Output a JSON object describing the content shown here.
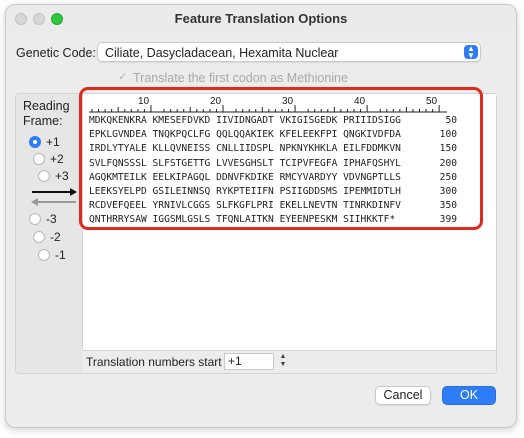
{
  "window": {
    "title": "Feature Translation Options"
  },
  "genetic_code": {
    "label": "Genetic Code:",
    "selected": "Ciliate, Dasycladacean, Hexamita Nuclear"
  },
  "methionine": {
    "label": "Translate the first codon as Methionine",
    "checked": true,
    "enabled": false
  },
  "reading_frame": {
    "label_line1": "Reading",
    "label_line2": "Frame:",
    "options": [
      "+1",
      "+2",
      "+3",
      "-3",
      "-2",
      "-1"
    ],
    "selected": "+1"
  },
  "ruler": {
    "ticks": [
      "10",
      "20",
      "30",
      "40",
      "50"
    ]
  },
  "sequence": {
    "lines": [
      {
        "seq": "MDKQKENKRA KMESEFDVKD IIVIDNGADT VKIGISGEDK PRIIIDSIGG",
        "num": "50"
      },
      {
        "seq": "EPKLGVNDEA TNQKPQCLFG QQLQQAKIEK KFELEEKFPI QNGKIVDFDA",
        "num": "100"
      },
      {
        "seq": "IRDLYTYALE KLLQVNEISS CNLLIIDSPL NPKNYKHKLA EILFDDMKVN",
        "num": "150"
      },
      {
        "seq": "SVLFQNSSSL SLFSTGETTG LVVESGHSLT TCIPVFEGFA IPHAFQSHYL",
        "num": "200"
      },
      {
        "seq": "AGQKMTEILK EELKIPAGQL DDNVFKDIKE RMCYVARDYY VDVNGPTLLS",
        "num": "250"
      },
      {
        "seq": "LEEKSYELPD GSILEINNSQ RYKPTEIIFN PSIIGDDSMS IPEMMIDTLH",
        "num": "300"
      },
      {
        "seq": "RCDVEFQEEL YRNIVLCGGS SLFKGFLPRI EKELLNEVTN TINRKDINFV",
        "num": "350"
      },
      {
        "seq": "QNTHRRYSAW IGGSMLGSLS TFQNLAITKN EYEENPESKM SIIHKKTF*",
        "num": "399"
      }
    ]
  },
  "translation_numbers": {
    "label": "Translation numbers start at",
    "value": "+1"
  },
  "buttons": {
    "cancel": "Cancel",
    "ok": "OK"
  },
  "colors": {
    "accent": "#2f7df6",
    "highlight": "#e02a1e"
  }
}
